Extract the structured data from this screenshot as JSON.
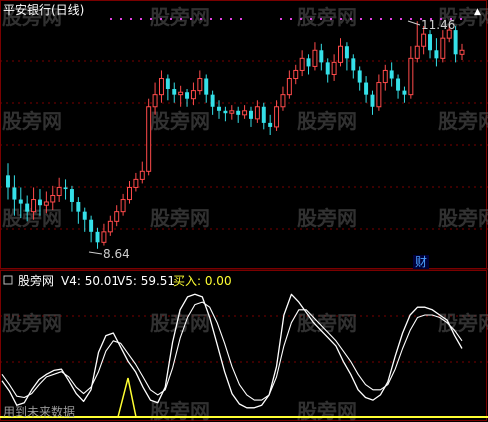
{
  "main_title": "平安银行(日线)",
  "watermark": "股旁网",
  "top_marker": "▲",
  "cai_label": "财",
  "price_high_label": "11.46",
  "price_low_label": "8.64",
  "sub_panel": {
    "name": "股旁网",
    "v4_label": "V4: 50.01",
    "v5_label": "V5: 59.51",
    "buy_label": "买入: 0.00"
  },
  "footer_text": "用到未来数据",
  "chart_data": [
    {
      "type": "candlestick",
      "title": "平安银行(日线)",
      "up_color": "#ff4b4b",
      "down_color": "#35e0e8",
      "annotations": [
        {
          "text": "11.46",
          "value": 11.46
        },
        {
          "text": "8.64",
          "value": 8.64
        }
      ],
      "candles": [
        [
          9.55,
          9.4,
          9.7,
          9.25
        ],
        [
          9.4,
          9.25,
          9.55,
          9.05
        ],
        [
          9.25,
          9.2,
          9.4,
          9.02
        ],
        [
          9.2,
          9.1,
          9.3,
          8.98
        ],
        [
          9.1,
          9.25,
          9.4,
          9.0
        ],
        [
          9.25,
          9.18,
          9.38,
          9.05
        ],
        [
          9.18,
          9.22,
          9.35,
          9.08
        ],
        [
          9.22,
          9.3,
          9.42,
          9.12
        ],
        [
          9.3,
          9.4,
          9.52,
          9.22
        ],
        [
          9.4,
          9.38,
          9.5,
          9.25
        ],
        [
          9.38,
          9.22,
          9.42,
          9.1
        ],
        [
          9.22,
          9.1,
          9.28,
          8.95
        ],
        [
          9.1,
          9.0,
          9.15,
          8.85
        ],
        [
          9.0,
          8.85,
          9.05,
          8.72
        ],
        [
          8.85,
          8.72,
          8.9,
          8.64
        ],
        [
          8.72,
          8.85,
          8.95,
          8.68
        ],
        [
          8.85,
          8.98,
          9.05,
          8.8
        ],
        [
          8.98,
          9.1,
          9.18,
          8.92
        ],
        [
          9.1,
          9.25,
          9.32,
          9.05
        ],
        [
          9.25,
          9.4,
          9.48,
          9.2
        ],
        [
          9.4,
          9.5,
          9.58,
          9.35
        ],
        [
          9.5,
          9.6,
          9.72,
          9.45
        ],
        [
          9.6,
          10.4,
          10.5,
          9.55
        ],
        [
          10.4,
          10.55,
          10.7,
          10.3
        ],
        [
          10.55,
          10.75,
          10.85,
          10.45
        ],
        [
          10.75,
          10.62,
          10.8,
          10.48
        ],
        [
          10.62,
          10.55,
          10.7,
          10.45
        ],
        [
          10.55,
          10.58,
          10.66,
          10.4
        ],
        [
          10.58,
          10.5,
          10.62,
          10.4
        ],
        [
          10.5,
          10.6,
          10.7,
          10.42
        ],
        [
          10.6,
          10.75,
          10.85,
          10.55
        ],
        [
          10.75,
          10.55,
          10.8,
          10.45
        ],
        [
          10.55,
          10.4,
          10.6,
          10.3
        ],
        [
          10.4,
          10.35,
          10.48,
          10.25
        ],
        [
          10.35,
          10.32,
          10.4,
          10.22
        ],
        [
          10.32,
          10.35,
          10.42,
          10.24
        ],
        [
          10.35,
          10.3,
          10.4,
          10.2
        ],
        [
          10.3,
          10.35,
          10.42,
          10.25
        ],
        [
          10.35,
          10.25,
          10.4,
          10.15
        ],
        [
          10.25,
          10.4,
          10.48,
          10.2
        ],
        [
          10.4,
          10.2,
          10.45,
          10.12
        ],
        [
          10.2,
          10.15,
          10.3,
          10.05
        ],
        [
          10.15,
          10.4,
          10.48,
          10.1
        ],
        [
          10.4,
          10.55,
          10.65,
          10.35
        ],
        [
          10.55,
          10.75,
          10.85,
          10.5
        ],
        [
          10.75,
          10.85,
          10.92,
          10.68
        ],
        [
          10.85,
          11.0,
          11.1,
          10.78
        ],
        [
          11.0,
          10.9,
          11.05,
          10.8
        ],
        [
          10.9,
          11.1,
          11.2,
          10.85
        ],
        [
          11.1,
          10.95,
          11.18,
          10.85
        ],
        [
          10.95,
          10.8,
          11.0,
          10.7
        ],
        [
          10.8,
          10.95,
          11.05,
          10.72
        ],
        [
          10.95,
          11.15,
          11.25,
          10.9
        ],
        [
          11.15,
          11.0,
          11.2,
          10.85
        ],
        [
          11.0,
          10.85,
          11.05,
          10.75
        ],
        [
          10.85,
          10.7,
          10.9,
          10.6
        ],
        [
          10.7,
          10.55,
          10.78,
          10.45
        ],
        [
          10.55,
          10.4,
          10.6,
          10.3
        ],
        [
          10.4,
          10.7,
          10.8,
          10.35
        ],
        [
          10.7,
          10.85,
          10.92,
          10.6
        ],
        [
          10.85,
          10.75,
          10.95,
          10.65
        ],
        [
          10.75,
          10.6,
          10.8,
          10.5
        ],
        [
          10.6,
          10.55,
          10.65,
          10.45
        ],
        [
          10.55,
          11.0,
          11.15,
          10.5
        ],
        [
          11.0,
          11.15,
          11.46,
          10.95
        ],
        [
          11.15,
          11.3,
          11.4,
          11.05
        ],
        [
          11.3,
          11.1,
          11.35,
          11.0
        ],
        [
          11.1,
          11.0,
          11.25,
          10.9
        ],
        [
          11.0,
          11.25,
          11.35,
          10.95
        ],
        [
          11.25,
          11.35,
          11.42,
          11.2
        ],
        [
          11.35,
          11.05,
          11.4,
          10.95
        ],
        [
          11.05,
          11.1,
          11.18,
          10.98
        ]
      ]
    },
    {
      "type": "line",
      "title": "",
      "series": [
        {
          "name": "V4",
          "color": "#ffffff",
          "values": [
            25,
            17,
            6,
            8,
            18,
            26,
            30,
            33,
            34,
            25,
            15,
            9,
            18,
            47,
            60,
            62,
            51,
            40,
            32,
            20,
            10,
            8,
            20,
            55,
            80,
            90,
            92,
            90,
            74,
            53,
            32,
            15,
            7,
            4,
            4,
            6,
            14,
            36,
            76,
            92,
            86,
            78,
            70,
            64,
            58,
            52,
            40,
            30,
            18,
            12,
            10,
            14,
            24,
            44,
            62,
            76,
            82,
            82,
            80,
            76,
            72,
            60,
            50
          ]
        },
        {
          "name": "V5",
          "color": "#ffffff",
          "values": [
            30,
            22,
            13,
            12,
            15,
            22,
            28,
            30,
            32,
            28,
            20,
            15,
            20,
            32,
            48,
            56,
            54,
            46,
            38,
            28,
            18,
            14,
            18,
            35,
            58,
            74,
            84,
            86,
            82,
            70,
            54,
            36,
            22,
            14,
            10,
            10,
            14,
            28,
            52,
            70,
            80,
            80,
            74,
            68,
            62,
            56,
            48,
            40,
            30,
            22,
            18,
            18,
            22,
            34,
            50,
            64,
            74,
            76,
            76,
            74,
            70,
            64,
            56
          ]
        },
        {
          "name": "买入",
          "color": "#ffff33",
          "values": [
            0,
            0,
            0,
            0,
            0,
            0,
            0,
            0,
            0,
            0,
            0,
            0,
            0,
            0,
            0,
            0,
            0,
            0,
            0,
            0,
            0,
            0,
            0,
            0,
            0,
            0,
            0,
            0,
            0,
            0,
            0,
            0,
            0,
            0,
            0,
            0,
            0,
            0,
            0,
            0,
            0,
            0,
            0,
            0,
            0,
            0,
            0,
            0,
            0,
            0,
            0,
            0,
            0,
            0,
            0,
            0,
            0,
            0,
            0,
            0,
            0,
            0,
            0
          ]
        }
      ]
    }
  ]
}
